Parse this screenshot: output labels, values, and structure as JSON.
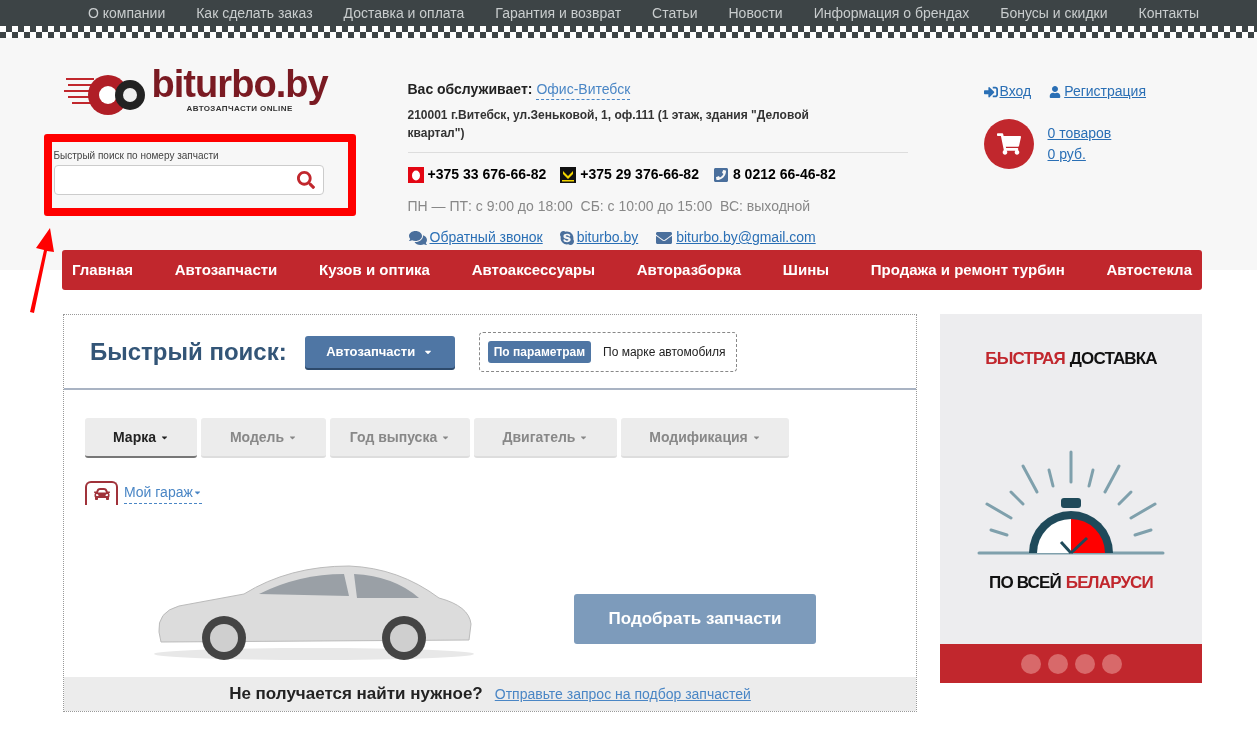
{
  "top_menu": [
    "О компании",
    "Как сделать заказ",
    "Доставка и оплата",
    "Гарантия и возврат",
    "Статьи",
    "Новости",
    "Информация о брендах",
    "Бонусы и скидки",
    "Контакты"
  ],
  "logo": {
    "name": "biturbo.by",
    "tagline": "АВТОЗАПЧАСТИ ONLINE"
  },
  "part_search": {
    "label": "Быстрый поиск по номеру запчасти"
  },
  "office": {
    "label": "Вас обслуживает:",
    "link": "Офис-Витебск",
    "address": "210001 г.Витебск, ул.Зеньковой, 1, оф.111 (1 этаж, здания \"Деловой квартал\")"
  },
  "phones": [
    {
      "kind": "mts",
      "number": "+375 33 676-66-82"
    },
    {
      "kind": "velcom",
      "number": "+375 29 376-66-82"
    },
    {
      "kind": "landline",
      "number": "8 0212 66-46-82"
    }
  ],
  "hours": "ПН — ПТ: с 9:00 до 18:00  СБ: с 10:00 до 15:00  ВС: выходной",
  "contacts": [
    {
      "kind": "callback",
      "text": "Обратный звонок"
    },
    {
      "kind": "skype",
      "text": "biturbo.by"
    },
    {
      "kind": "email",
      "text": "biturbo.by@gmail.com"
    }
  ],
  "account": {
    "login": "Вход",
    "register": "Регистрация"
  },
  "cart": {
    "items": "0 товаров",
    "sum": "0 руб."
  },
  "main_menu": [
    "Главная",
    "Автозапчасти",
    "Кузов и оптика",
    "Автоаксессуары",
    "Авторазборка",
    "Шины",
    "Продажа и ремонт турбин",
    "Автостекла"
  ],
  "quick_search": {
    "title": "Быстрый поиск:",
    "category": "Автозапчасти",
    "modes": [
      {
        "label": "По параметрам",
        "selected": true
      },
      {
        "label": "По марке автомобиля",
        "selected": false
      }
    ],
    "filters": [
      {
        "label": "Марка",
        "selected": true
      },
      {
        "label": "Модель",
        "selected": false
      },
      {
        "label": "Год выпуска",
        "selected": false
      },
      {
        "label": "Двигатель",
        "selected": false
      },
      {
        "label": "Модификация",
        "selected": false
      }
    ],
    "garage": "Мой гараж",
    "submit": "Подобрать запчасти",
    "footer_question": "Не получается найти нужное?",
    "footer_link": "Отправьте запрос на подбор запчастей"
  },
  "banner": {
    "headline": [
      {
        "text": "БЫСТРАЯ",
        "accent": true
      },
      {
        "text": "ДОСТАВКА",
        "accent": false
      }
    ],
    "subline": [
      {
        "text": "ПО ВСЕЙ",
        "accent": false
      },
      {
        "text": "БЕЛАРУСИ",
        "accent": true
      }
    ]
  }
}
